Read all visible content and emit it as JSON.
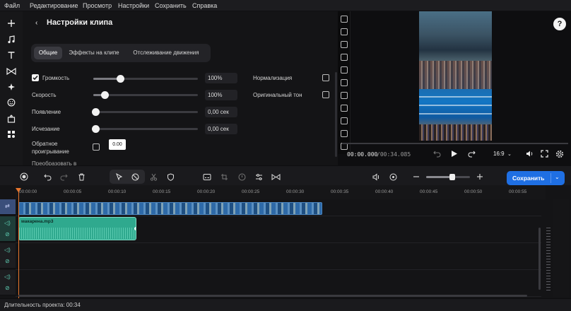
{
  "menu": [
    "Файл",
    "Редактирование",
    "Просмотр",
    "Настройки",
    "Сохранить",
    "Справка"
  ],
  "left_tools": [
    "plus-icon",
    "music-note-icon",
    "text-icon",
    "transition-icon",
    "sparkle-icon",
    "sticker-icon",
    "apps-icon",
    "more-icon"
  ],
  "panel": {
    "title": "Настройки клипа",
    "tabs": [
      "Общие",
      "Эффекты на клипе",
      "Отслеживание движения"
    ],
    "active_tab": 0,
    "volume": {
      "label": "Громкость",
      "value": "100%",
      "level": 0.27,
      "checked": true
    },
    "speed": {
      "label": "Скорость",
      "value": "100%",
      "level": 0.12
    },
    "fade_in": {
      "label": "Появление",
      "value": "0,00 сек",
      "level": 0
    },
    "fade_out": {
      "label": "Исчезание",
      "value": "0,00 сек",
      "level": 0
    },
    "reverse": {
      "label_line1": "Обратное",
      "label_line2": "проигрывание",
      "value": "0.00"
    },
    "convert": {
      "label": "Преобразовать в"
    },
    "normalize": {
      "label": "Нормализация"
    },
    "original_tone": {
      "label": "Оригинальный тон"
    }
  },
  "preview": {
    "help": "?",
    "time_current": "00:00.000",
    "time_total": "/00:34.085",
    "ratio": "16:9"
  },
  "toolbar": {
    "save_label": "Сохранить"
  },
  "ruler_ticks": [
    "00:00:00",
    "00:00:05",
    "00:00:10",
    "00:00:15",
    "00:00:20",
    "00:00:25",
    "00:00:30",
    "00:00:35",
    "00:00:40",
    "00:00:45",
    "00:00:50",
    "00:00:55"
  ],
  "audio_clip": {
    "name": "макарена.mp3"
  },
  "status": {
    "duration_label": "Длительность проекта: 00:34"
  },
  "colors": {
    "accent": "#1f6fe3",
    "audio": "#2fa98e",
    "video_track": "#3d7bb8",
    "playhead": "#e8762d"
  }
}
